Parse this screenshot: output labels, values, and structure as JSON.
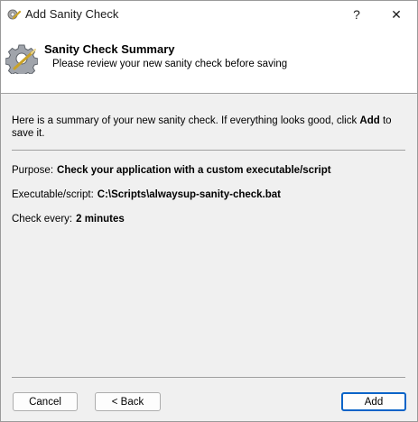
{
  "window": {
    "title": "Add Sanity Check",
    "help_label": "?",
    "close_label": "✕"
  },
  "header": {
    "title": "Sanity Check Summary",
    "subtitle": "Please review your new sanity check before saving"
  },
  "intro": {
    "text_before": "Here is a summary of your new sanity check. If everything looks good, click ",
    "emphasis": "Add",
    "text_after": " to save it."
  },
  "summary": {
    "purpose_label": "Purpose:",
    "purpose_value": "Check your application with a custom executable/script",
    "executable_label": "Executable/script:",
    "executable_value": "C:\\Scripts\\alwaysup-sanity-check.bat",
    "check_label": "Check every:",
    "check_value": "2 minutes"
  },
  "buttons": {
    "cancel": "Cancel",
    "back": "< Back",
    "add": "Add"
  },
  "icons": {
    "app": "gear-app-icon",
    "wizard": "gear-check-icon"
  },
  "colors": {
    "default_button_border": "#0a64c8",
    "background": "#f0f0f0",
    "header_background": "#ffffff"
  }
}
